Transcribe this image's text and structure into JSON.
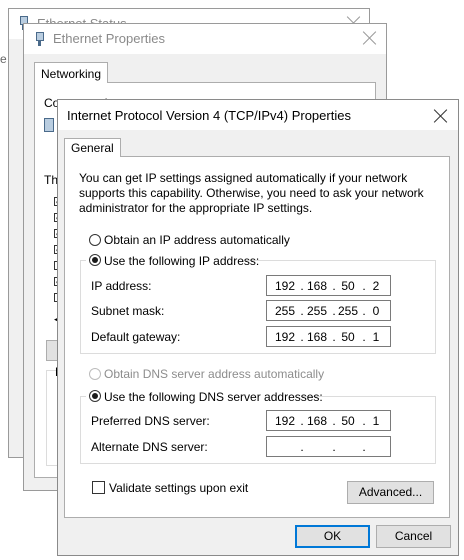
{
  "ethernet_status": {
    "title": "Ethernet Status",
    "left_fragment": "e"
  },
  "ethernet_properties": {
    "title": "Ethernet Properties",
    "tab": "Networking",
    "connect_using_label": "Connect using:",
    "this_connection_label": "Th"
  },
  "ipv4_dialog": {
    "title": "Internet Protocol Version 4 (TCP/IPv4) Properties",
    "tab": "General",
    "description": "You can get IP settings assigned automatically if your network supports this capability. Otherwise, you need to ask your network administrator for the appropriate IP settings.",
    "ip_mode": {
      "auto_label": "Obtain an IP address automatically",
      "manual_label": "Use the following IP address:",
      "selected": "manual"
    },
    "ip_address": {
      "label": "IP address:",
      "octets": [
        "192",
        "168",
        "50",
        "2"
      ]
    },
    "subnet_mask": {
      "label": "Subnet mask:",
      "octets": [
        "255",
        "255",
        "255",
        "0"
      ]
    },
    "default_gateway": {
      "label": "Default gateway:",
      "octets": [
        "192",
        "168",
        "50",
        "1"
      ]
    },
    "dns_mode": {
      "auto_label": "Obtain DNS server address automatically",
      "manual_label": "Use the following DNS server addresses:",
      "selected": "manual"
    },
    "preferred_dns": {
      "label": "Preferred DNS server:",
      "octets": [
        "192",
        "168",
        "50",
        "1"
      ]
    },
    "alternate_dns": {
      "label": "Alternate DNS server:",
      "octets": [
        "",
        "",
        "",
        ""
      ]
    },
    "validate": {
      "label": "Validate settings upon exit",
      "checked": false
    },
    "advanced_label": "Advanced...",
    "ok_label": "OK",
    "cancel_label": "Cancel"
  },
  "colors": {
    "accent": "#0078d7",
    "window_bg": "#f0f0f0",
    "titlebar_bg": "#ffffff"
  }
}
